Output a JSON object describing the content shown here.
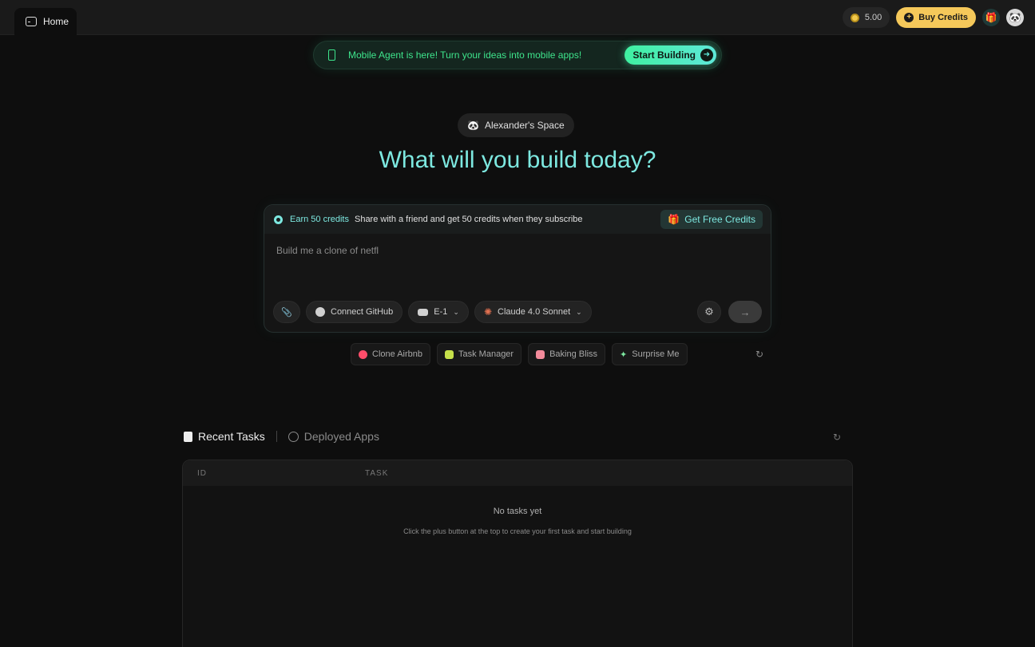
{
  "topbar": {
    "home_tab": "Home",
    "credits": "5.00",
    "buy_credits": "Buy Credits"
  },
  "banner": {
    "text": "Mobile Agent is here! Turn your ideas into mobile apps!",
    "button": "Start Building"
  },
  "space": {
    "name": "Alexander's Space"
  },
  "headline": "What will you build today?",
  "prompt": {
    "earn_label": "Earn 50 credits",
    "earn_desc": "Share with a friend and get 50 credits when they subscribe",
    "free_credits": "Get Free Credits",
    "input_value": "Build me a clone of netfl",
    "connect_github": "Connect GitHub",
    "agent": "E-1",
    "model": "Claude 4.0 Sonnet"
  },
  "suggestions": [
    {
      "label": "Clone Airbnb",
      "color": "#ff4d6a"
    },
    {
      "label": "Task Manager",
      "color": "#c6e04a"
    },
    {
      "label": "Baking Bliss",
      "color": "#f28a9a"
    },
    {
      "label": "Surprise Me",
      "color": "#7de8a0"
    }
  ],
  "tasks": {
    "tab_recent": "Recent Tasks",
    "tab_deployed": "Deployed Apps",
    "col_id": "ID",
    "col_task": "TASK",
    "empty_title": "No tasks yet",
    "empty_sub": "Click the plus button at the top to create your first task and start building"
  },
  "colors": {
    "accent": "#7de8e0",
    "banner_green": "#3ee58c",
    "buy_yellow": "#f5c85a"
  }
}
